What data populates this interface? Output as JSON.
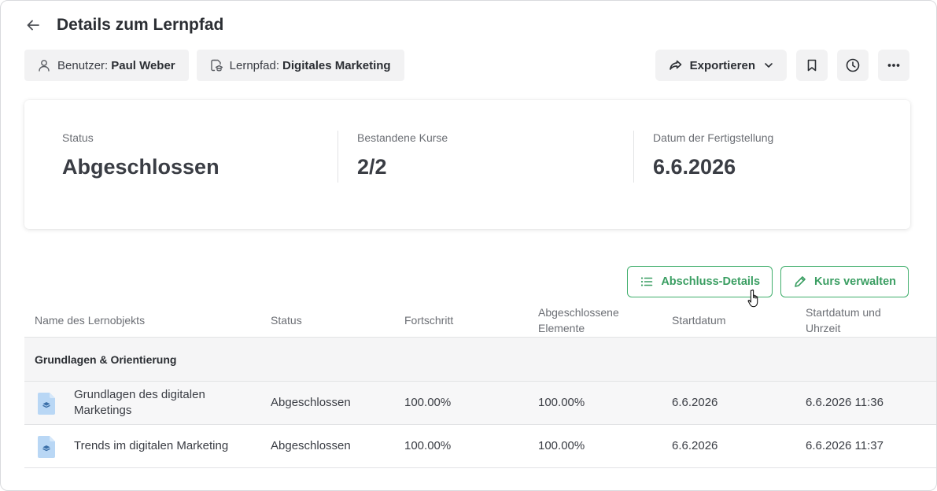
{
  "header": {
    "title": "Details zum Lernpfad"
  },
  "chips": {
    "user_label": "Benutzer:",
    "user_value": "Paul Weber",
    "path_label": "Lernpfad:",
    "path_value": "Digitales Marketing"
  },
  "actions": {
    "export_label": "Exportieren",
    "icons": [
      "bookmark-icon",
      "history-icon",
      "more-icon"
    ]
  },
  "summary": {
    "status_label": "Status",
    "status_value": "Abgeschlossen",
    "courses_label": "Bestandene Kurse",
    "courses_value": "2/2",
    "date_label": "Datum der Fertigstellung",
    "date_value": "6.6.2026"
  },
  "table_actions": {
    "completion_details": "Abschluss-Details",
    "manage_course": "Kurs verwalten"
  },
  "table": {
    "headers": {
      "name": "Name des Lernobjekts",
      "status": "Status",
      "progress": "Fortschritt",
      "completed_line1": "Abgeschlossene",
      "completed_line2": "Elemente",
      "start_date": "Startdatum",
      "start_datetime_line1": "Startdatum und",
      "start_datetime_line2": "Uhrzeit"
    },
    "group": "Grundlagen & Orientierung",
    "rows": [
      {
        "name_line1": "Grundlagen des digitalen",
        "name_line2": "Marketings",
        "status": "Abgeschlossen",
        "progress": "100.00%",
        "completed": "100.00%",
        "start_date": "6.6.2026",
        "start_datetime": "6.6.2026 11:36"
      },
      {
        "name_line1": "Trends im digitalen Marketing",
        "name_line2": "",
        "status": "Abgeschlossen",
        "progress": "100.00%",
        "completed": "100.00%",
        "start_date": "6.6.2026",
        "start_datetime": "6.6.2026 11:37"
      }
    ]
  },
  "colors": {
    "accent_green": "#3fae6b",
    "doc_icon_blue": "#b9d7f5"
  }
}
